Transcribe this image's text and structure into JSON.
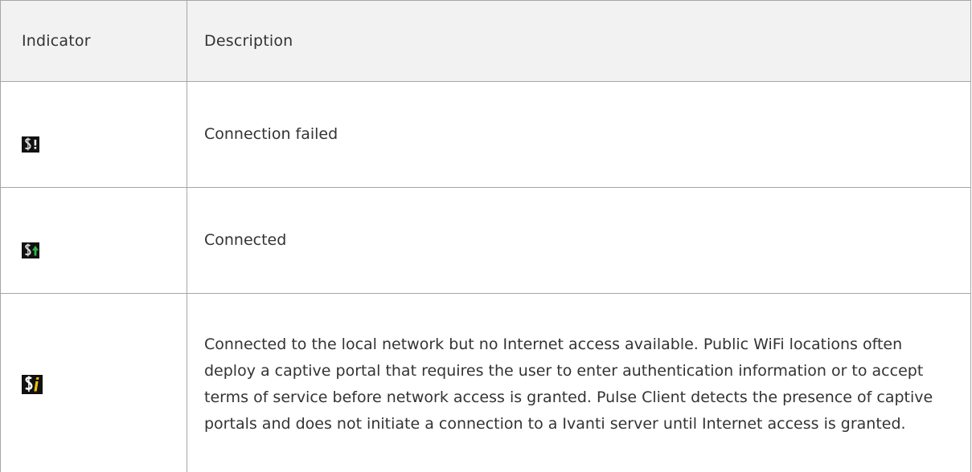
{
  "table": {
    "headers": {
      "indicator": "Indicator",
      "description": "Description"
    },
    "rows": [
      {
        "icon": "connection-failed-icon",
        "description": "Connection failed"
      },
      {
        "icon": "connected-icon",
        "description": "Connected"
      },
      {
        "icon": "captive-portal-icon",
        "description": "Connected to the local network but no Internet access available. Public WiFi locations often deploy a captive portal that requires the user to enter authentication information or to accept terms of service before network access is granted. Pulse Client detects the presence of captive portals and does not initiate a connection to a Ivanti server until Internet access is granted."
      }
    ]
  },
  "colors": {
    "border": "#a6a6a6",
    "header_background": "#f2f2f2",
    "text": "#333333",
    "icon_background": "#111111",
    "connected_arrow": "#2fb34a",
    "captive_info": "#f2c200"
  }
}
